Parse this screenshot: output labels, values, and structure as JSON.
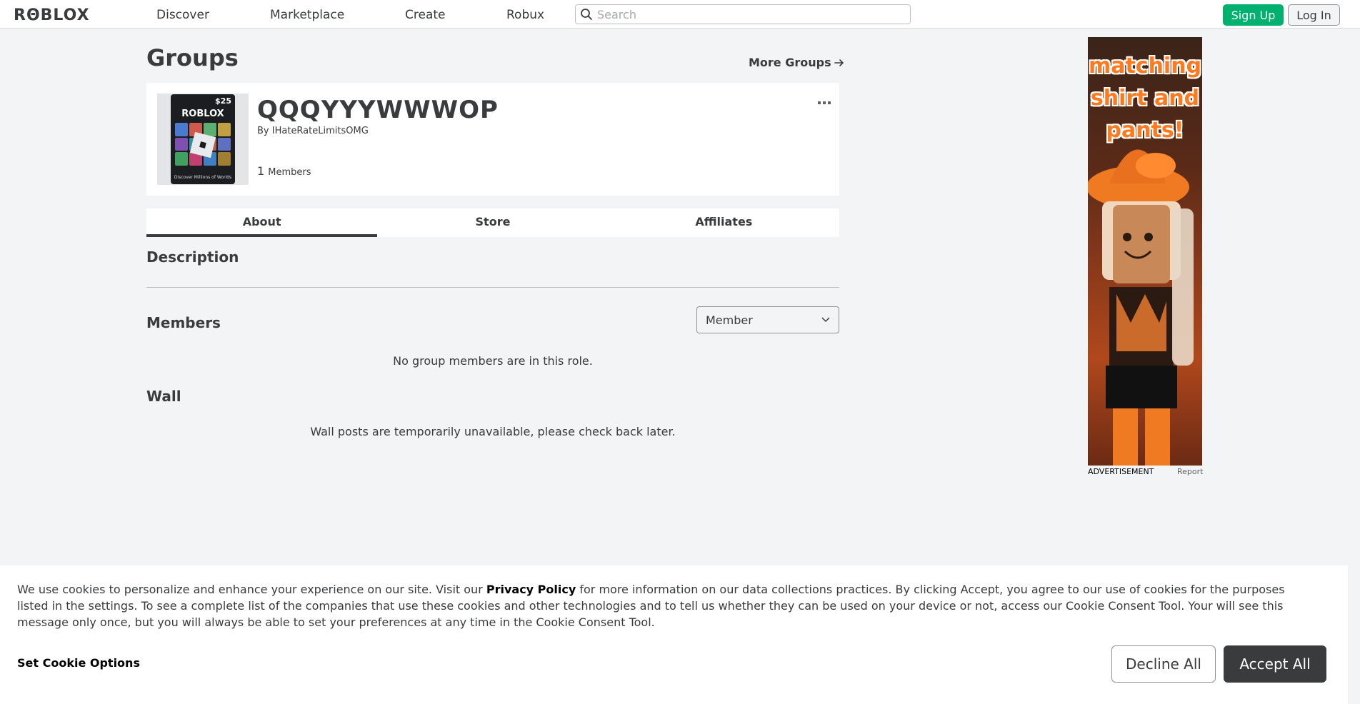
{
  "nav": {
    "logo": "RΘBLOX",
    "links": [
      "Discover",
      "Marketplace",
      "Create",
      "Robux"
    ],
    "search_placeholder": "Search",
    "signup": "Sign Up",
    "login": "Log In"
  },
  "page": {
    "title": "Groups",
    "more_groups": "More Groups"
  },
  "group": {
    "name": "QQQYYYWWWOP",
    "by_label": "By",
    "owner": "IHateRateLimitsOMG",
    "member_count": "1",
    "members_label": "Members",
    "thumb": {
      "price": "$25",
      "logo": "ROBLOX",
      "caption": "Discover Millions of Worlds"
    }
  },
  "tabs": [
    "About",
    "Store",
    "Affiliates"
  ],
  "sections": {
    "description": "Description",
    "members": "Members",
    "role_selected": "Member",
    "members_empty": "No group members are in this role.",
    "wall": "Wall",
    "wall_empty": "Wall posts are temporarily unavailable, please check back later."
  },
  "ad": {
    "lines": [
      "matching",
      "shirt and",
      "pants!"
    ],
    "label": "ADVERTISEMENT",
    "report": "Report"
  },
  "cookie": {
    "text_before": "We use cookies to personalize and enhance your experience on our site. Visit our ",
    "privacy_link": "Privacy Policy",
    "text_after": " for more information on our data collections practices. By clicking Accept, you agree to our use of cookies for the purposes listed in the settings. To see a complete list of the companies that use these cookies and other technologies and to tell us whether they can be used on your device or not, access our Cookie Consent Tool. Your will see this message only once, but you will always be able to set your preferences at any time in the Cookie Consent Tool.",
    "set_options": "Set Cookie Options",
    "decline": "Decline All",
    "accept": "Accept All"
  },
  "colors": {
    "accent_green": "#00b06f",
    "text_dark": "#393b3d",
    "background": "#f2f4f5"
  }
}
